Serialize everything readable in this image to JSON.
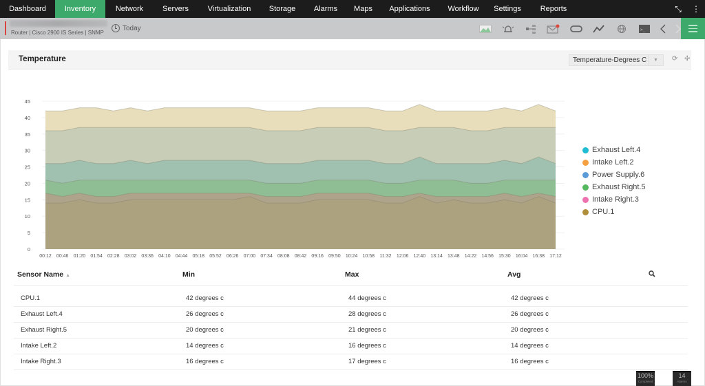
{
  "nav": {
    "tabs": [
      {
        "label": "Dashboard",
        "active": false
      },
      {
        "label": "Inventory",
        "active": true
      },
      {
        "label": "Network",
        "active": false
      },
      {
        "label": "Servers",
        "active": false
      },
      {
        "label": "Virtualization",
        "active": false
      },
      {
        "label": "Storage",
        "active": false
      },
      {
        "label": "Alarms",
        "active": false
      },
      {
        "label": "Maps",
        "active": false
      },
      {
        "label": "Applications",
        "active": false
      },
      {
        "label": "Workflow",
        "active": false
      },
      {
        "label": "Settings",
        "active": false
      },
      {
        "label": "Reports",
        "active": false
      }
    ],
    "accent_color": "#3daa6b"
  },
  "device": {
    "info": "Router | Cisco 2900 IS Series  | SNMP",
    "period": "Today"
  },
  "toolbar_icons": [
    "graph-image-icon",
    "alarm-bell-icon",
    "topology-icon",
    "mail-icon",
    "loop-icon",
    "line-chart-icon",
    "globe-icon",
    "terminal-icon",
    "prev-icon",
    "next-icon"
  ],
  "panel": {
    "title": "Temperature",
    "select_value": "Temperature-Degrees C"
  },
  "chart_data": {
    "type": "area",
    "title": "Temperature",
    "xlabel": "",
    "ylabel": "",
    "ylim": [
      0,
      45
    ],
    "yticks": [
      0,
      5,
      10,
      15,
      20,
      25,
      30,
      35,
      40,
      45
    ],
    "grid": true,
    "legend_position": "right",
    "x": [
      "00:12",
      "00:46",
      "01:20",
      "01:54",
      "02:28",
      "03:02",
      "03:36",
      "04:10",
      "04:44",
      "05:18",
      "05:52",
      "06:26",
      "07:00",
      "07:34",
      "08:08",
      "08:42",
      "09:16",
      "09:50",
      "10:24",
      "10:58",
      "11:32",
      "12:06",
      "12:40",
      "13:14",
      "13:48",
      "14:22",
      "14:56",
      "15:30",
      "16:04",
      "16:38",
      "17:12"
    ],
    "series": [
      {
        "name": "CPU.1",
        "color": "#e8dcb8",
        "values": [
          42,
          42,
          43,
          43,
          42,
          43,
          42,
          43,
          43,
          43,
          43,
          43,
          43,
          42,
          42,
          42,
          43,
          43,
          43,
          43,
          42,
          42,
          44,
          42,
          42,
          42,
          42,
          43,
          42,
          44,
          42
        ]
      },
      {
        "name": "Power Supply.6",
        "color": "#c5cbb5",
        "values": [
          36,
          36,
          37,
          37,
          37,
          37,
          37,
          37,
          37,
          37,
          37,
          37,
          37,
          36,
          36,
          36,
          37,
          37,
          37,
          37,
          36,
          36,
          37,
          37,
          37,
          36,
          36,
          37,
          37,
          37,
          37
        ]
      },
      {
        "name": "Exhaust Left.4",
        "color": "#9ebfb0",
        "values": [
          26,
          26,
          27,
          26,
          26,
          27,
          26,
          27,
          27,
          27,
          27,
          27,
          27,
          26,
          26,
          26,
          27,
          27,
          27,
          27,
          26,
          26,
          28,
          26,
          26,
          26,
          26,
          27,
          26,
          28,
          26
        ]
      },
      {
        "name": "Exhaust Right.5",
        "color": "#8fbe92",
        "values": [
          21,
          20,
          21,
          21,
          21,
          21,
          21,
          21,
          21,
          21,
          21,
          21,
          21,
          20,
          20,
          20,
          21,
          21,
          21,
          21,
          20,
          20,
          21,
          21,
          21,
          20,
          20,
          21,
          21,
          21,
          21
        ]
      },
      {
        "name": "Intake Right.3",
        "color": "#b0a28a",
        "values": [
          17,
          16,
          17,
          16,
          16,
          17,
          17,
          17,
          17,
          17,
          17,
          17,
          17,
          16,
          16,
          16,
          17,
          17,
          17,
          17,
          16,
          16,
          17,
          16,
          16,
          16,
          16,
          17,
          16,
          17,
          16
        ]
      },
      {
        "name": "Intake Left.2",
        "color": "#ada27f",
        "values": [
          14,
          14,
          15,
          14,
          14,
          15,
          15,
          15,
          15,
          15,
          15,
          15,
          16,
          14,
          14,
          14,
          15,
          15,
          15,
          15,
          14,
          14,
          16,
          14,
          15,
          14,
          14,
          15,
          14,
          16,
          14
        ]
      }
    ],
    "legend": [
      {
        "name": "Exhaust Left.4",
        "color": "#1fbcd3"
      },
      {
        "name": "Intake Left.2",
        "color": "#f5a142"
      },
      {
        "name": "Power Supply.6",
        "color": "#5a9bd8"
      },
      {
        "name": "Exhaust Right.5",
        "color": "#55b75e"
      },
      {
        "name": "Intake Right.3",
        "color": "#ee72b0"
      },
      {
        "name": "CPU.1",
        "color": "#b08d3b"
      }
    ]
  },
  "table": {
    "headers": {
      "name": "Sensor Name",
      "min": "Min",
      "max": "Max",
      "avg": "Avg"
    },
    "rows": [
      {
        "name": "CPU.1",
        "min": "42 degrees c",
        "max": "44 degrees c",
        "avg": "42 degrees c"
      },
      {
        "name": "Exhaust Left.4",
        "min": "26 degrees c",
        "max": "28 degrees c",
        "avg": "26 degrees c"
      },
      {
        "name": "Exhaust Right.5",
        "min": "20 degrees c",
        "max": "21 degrees c",
        "avg": "20 degrees c"
      },
      {
        "name": "Intake Left.2",
        "min": "14 degrees c",
        "max": "16 degrees c",
        "avg": "14 degrees c"
      },
      {
        "name": "Intake Right.3",
        "min": "16 degrees c",
        "max": "17 degrees c",
        "avg": "16 degrees c"
      }
    ]
  },
  "status": {
    "completed_value": "100%",
    "completed_label": "Completed",
    "alarms_value": "14",
    "alarms_label": "Alarms"
  }
}
